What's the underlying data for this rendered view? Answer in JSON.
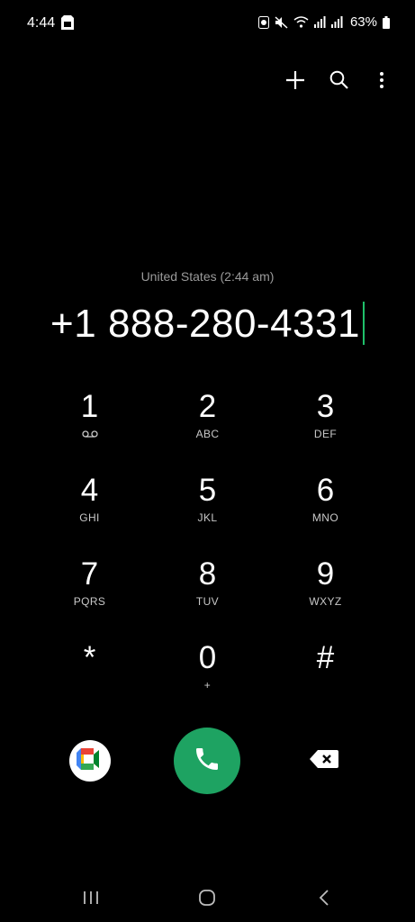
{
  "status_bar": {
    "time": "4:44",
    "battery_percent": "63%"
  },
  "dialer": {
    "region_label": "United States (2:44 am)",
    "number": "+1 888-280-4331"
  },
  "keypad": {
    "k1": {
      "digit": "1",
      "letters": ""
    },
    "k2": {
      "digit": "2",
      "letters": "ABC"
    },
    "k3": {
      "digit": "3",
      "letters": "DEF"
    },
    "k4": {
      "digit": "4",
      "letters": "GHI"
    },
    "k5": {
      "digit": "5",
      "letters": "JKL"
    },
    "k6": {
      "digit": "6",
      "letters": "MNO"
    },
    "k7": {
      "digit": "7",
      "letters": "PQRS"
    },
    "k8": {
      "digit": "8",
      "letters": "TUV"
    },
    "k9": {
      "digit": "9",
      "letters": "WXYZ"
    },
    "kstar": {
      "digit": "*",
      "letters": ""
    },
    "k0": {
      "digit": "0",
      "letters": "+"
    },
    "khash": {
      "digit": "#",
      "letters": ""
    }
  },
  "colors": {
    "background": "#000000",
    "call_green": "#1ea362",
    "caret_green": "#1fc06a",
    "secondary_text": "#9a9a9a"
  },
  "icons": {
    "add": "plus-icon",
    "search": "search-icon",
    "more": "more-vert-icon",
    "voicemail": "voicemail-icon",
    "meet": "google-meet-icon",
    "call": "phone-icon",
    "backspace": "backspace-icon",
    "recents": "recent-apps-icon",
    "home": "home-icon",
    "back": "back-icon"
  }
}
